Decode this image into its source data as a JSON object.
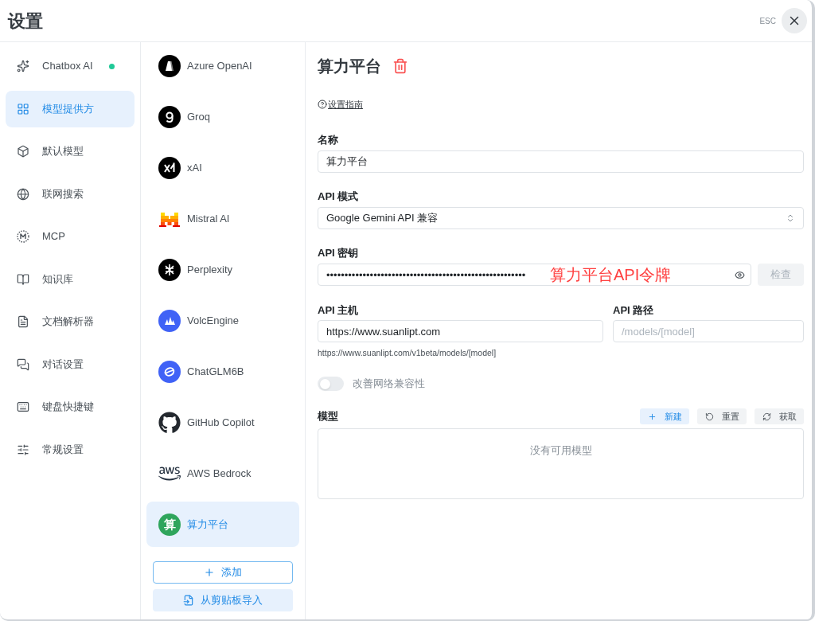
{
  "window": {
    "title": "设置",
    "esc_hint": "ESC"
  },
  "sidebar": {
    "items": [
      {
        "label": "Chatbox AI",
        "kind": "sparkles",
        "selected": false,
        "dot": true
      },
      {
        "label": "模型提供方",
        "kind": "grid",
        "selected": true,
        "dot": false
      },
      {
        "label": "默认模型",
        "kind": "cube",
        "selected": false,
        "dot": false
      },
      {
        "label": "联网搜索",
        "kind": "globe",
        "selected": false,
        "dot": false
      },
      {
        "label": "MCP",
        "kind": "mcp",
        "selected": false,
        "dot": false
      },
      {
        "label": "知识库",
        "kind": "book",
        "selected": false,
        "dot": false
      },
      {
        "label": "文档解析器",
        "kind": "file",
        "selected": false,
        "dot": false
      },
      {
        "label": "对话设置",
        "kind": "chat",
        "selected": false,
        "dot": false
      },
      {
        "label": "键盘快捷键",
        "kind": "keyboard",
        "selected": false,
        "dot": false
      },
      {
        "label": "常规设置",
        "kind": "sliders",
        "selected": false,
        "dot": false
      }
    ]
  },
  "providers": {
    "items": [
      {
        "name": "Azure OpenAI",
        "kind": "azure",
        "selected": false
      },
      {
        "name": "Groq",
        "kind": "groq",
        "selected": false
      },
      {
        "name": "xAI",
        "kind": "xai",
        "selected": false
      },
      {
        "name": "Mistral AI",
        "kind": "mistral",
        "selected": false
      },
      {
        "name": "Perplexity",
        "kind": "perplexity",
        "selected": false
      },
      {
        "name": "VolcEngine",
        "kind": "volcengine",
        "selected": false
      },
      {
        "name": "ChatGLM6B",
        "kind": "chatglm",
        "selected": false
      },
      {
        "name": "GitHub Copilot",
        "kind": "github",
        "selected": false
      },
      {
        "name": "AWS Bedrock",
        "kind": "aws",
        "selected": false
      },
      {
        "name": "算力平台",
        "kind": "letter",
        "avatar": "算",
        "selected": true
      }
    ],
    "add_button": "添加",
    "import_button": "从剪贴板导入"
  },
  "detail": {
    "title": "算力平台",
    "guide_link": "设置指南",
    "name_field": {
      "label": "名称",
      "value": "算力平台"
    },
    "api_mode": {
      "label": "API 模式",
      "value": "Google Gemini API 兼容"
    },
    "api_key": {
      "label": "API 密钥",
      "value": "•••••••••••••••••••••••••••••••••••••••••••••••••••••••",
      "annotation": "算力平台API令牌",
      "check_button": "检查",
      "check_disabled": true
    },
    "api_host": {
      "label": "API 主机",
      "value": "https://www.suanlipt.com"
    },
    "api_path": {
      "label": "API 路径",
      "placeholder": "/models/[model]"
    },
    "endpoint_preview": "https://www.suanlipt.com/v1beta/models/[model]",
    "network_compat": {
      "label": "改善网络兼容性",
      "on": false
    },
    "models": {
      "label": "模型",
      "buttons": [
        {
          "label": "新建",
          "kind": "new"
        },
        {
          "label": "重置",
          "kind": "reset"
        },
        {
          "label": "获取",
          "kind": "fetch"
        }
      ],
      "empty_text": "没有可用模型"
    }
  }
}
